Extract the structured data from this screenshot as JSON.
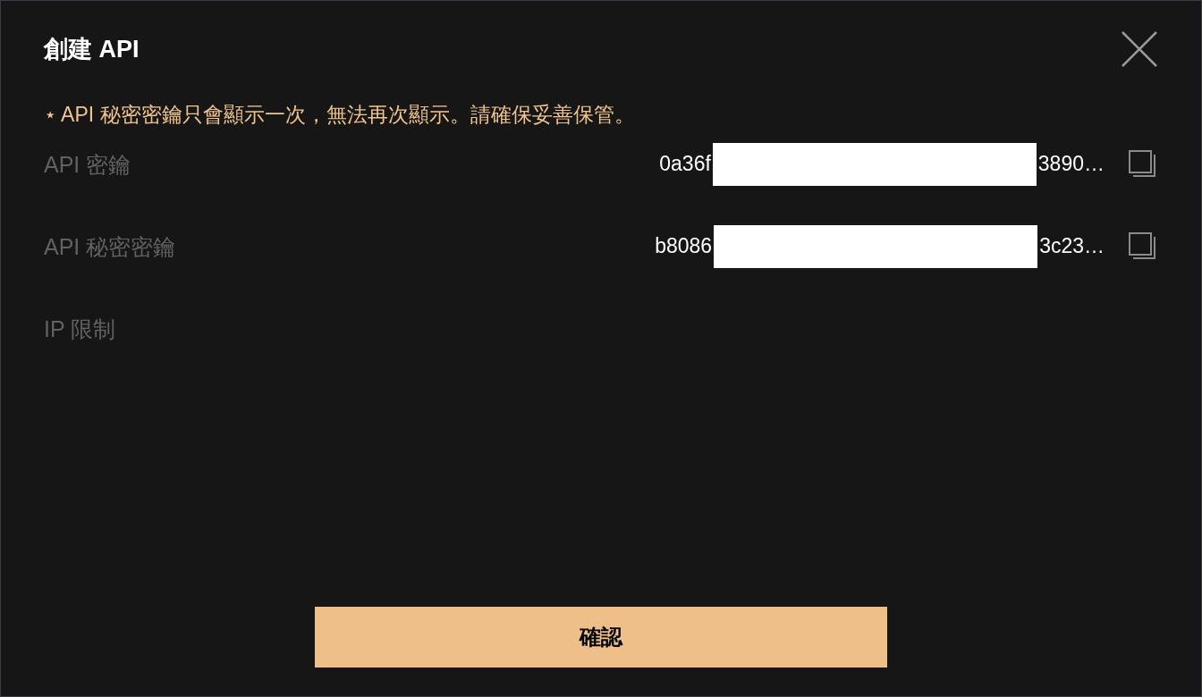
{
  "dialog": {
    "title": "創建 API",
    "notice": "⋆ API 秘密密鑰只會顯示一次，無法再次顯示。請確保妥善保管。",
    "fields": [
      {
        "label": "API 密鑰",
        "value_start": "0a36f",
        "value_end": "3890…",
        "redacted": true,
        "copyable": true
      },
      {
        "label": "API 秘密密鑰",
        "value_start": "b8086",
        "value_end": "3c23…",
        "redacted": true,
        "copyable": true
      },
      {
        "label": "IP 限制",
        "copyable": false
      }
    ],
    "confirm_button": "確認"
  }
}
